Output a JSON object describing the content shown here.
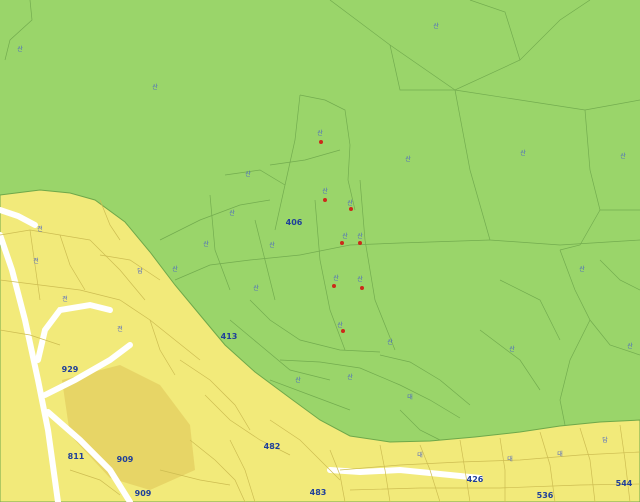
{
  "map": {
    "colors": {
      "forest_zone": "#9ad56a",
      "urban_zone": "#f2ea7a",
      "zone_boundary": "#6ea84a",
      "parcel_line_green": "#73ac4f",
      "parcel_line_yellow": "#cdbd52",
      "road": "#ffffff",
      "block": "#e3cc5e",
      "label_text": "#4a63c7",
      "marker": "#cc2a1a"
    },
    "district_numbers": [
      {
        "text": "406"
      },
      {
        "text": "413"
      },
      {
        "text": "929"
      },
      {
        "text": "909"
      },
      {
        "text": "811"
      },
      {
        "text": "909"
      },
      {
        "text": "482"
      },
      {
        "text": "483"
      },
      {
        "text": "426"
      },
      {
        "text": "536"
      },
      {
        "text": "544"
      }
    ],
    "parcel_labels": [
      {
        "text": "산"
      },
      {
        "text": "산"
      },
      {
        "text": "산"
      },
      {
        "text": "산"
      },
      {
        "text": "산"
      },
      {
        "text": "산"
      },
      {
        "text": "산"
      },
      {
        "text": "산"
      },
      {
        "text": "산"
      },
      {
        "text": "산"
      },
      {
        "text": "산"
      },
      {
        "text": "산"
      },
      {
        "text": "산"
      },
      {
        "text": "산"
      },
      {
        "text": "산"
      },
      {
        "text": "산"
      },
      {
        "text": "산"
      },
      {
        "text": "산"
      },
      {
        "text": "산"
      },
      {
        "text": "산"
      },
      {
        "text": "산"
      },
      {
        "text": "산"
      },
      {
        "text": "산"
      },
      {
        "text": "산"
      },
      {
        "text": "산"
      },
      {
        "text": "산"
      },
      {
        "text": "전"
      },
      {
        "text": "전"
      },
      {
        "text": "전"
      },
      {
        "text": "전"
      },
      {
        "text": "대"
      },
      {
        "text": "대"
      },
      {
        "text": "대"
      },
      {
        "text": "대"
      },
      {
        "text": "답"
      },
      {
        "text": "답"
      }
    ],
    "markers_count_label": ""
  }
}
